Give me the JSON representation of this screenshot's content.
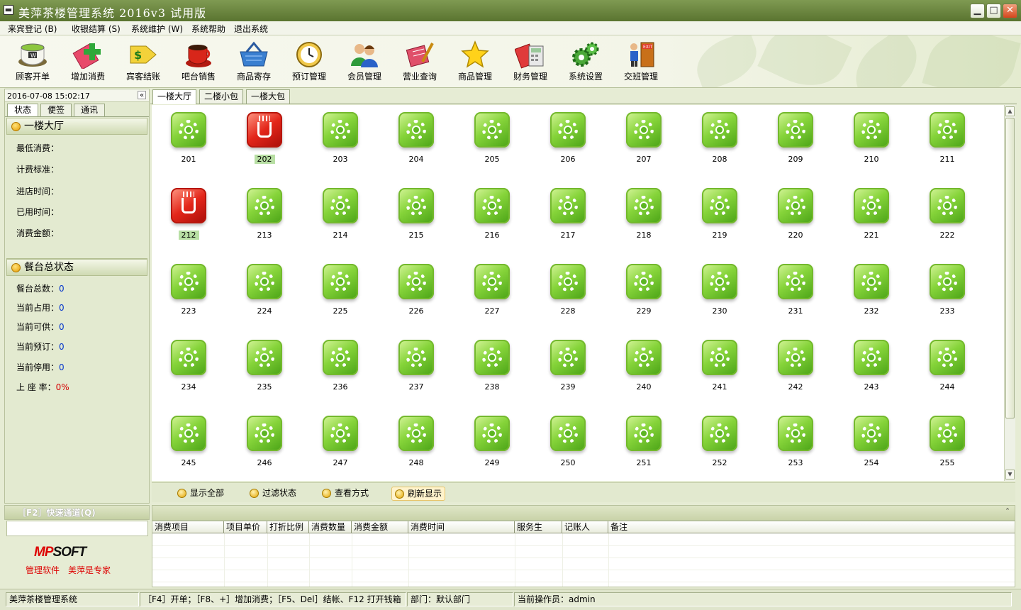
{
  "window": {
    "title": "美萍茶楼管理系统 2016v3 试用版",
    "controls": [
      "minimize",
      "maximize",
      "close"
    ]
  },
  "menu": [
    {
      "label": "来宾登记 (B)"
    },
    {
      "label": "收银结算 (S)"
    },
    {
      "label": "系统维护 (W)"
    },
    {
      "label": "系统帮助"
    },
    {
      "label": "退出系统"
    }
  ],
  "toolbar": [
    {
      "label": "顾客开单",
      "icon": "tea-cup-icon"
    },
    {
      "label": "增加消费",
      "icon": "add-consumption-icon"
    },
    {
      "label": "宾客结账",
      "icon": "checkout-icon"
    },
    {
      "label": "吧台销售",
      "icon": "bar-cup-icon"
    },
    {
      "label": "商品寄存",
      "icon": "basket-icon"
    },
    {
      "label": "预订管理",
      "icon": "clock-icon"
    },
    {
      "label": "会员管理",
      "icon": "members-icon"
    },
    {
      "label": "营业查询",
      "icon": "query-icon"
    },
    {
      "label": "商品管理",
      "icon": "star-icon"
    },
    {
      "label": "财务管理",
      "icon": "calculator-icon"
    },
    {
      "label": "系统设置",
      "icon": "gears-icon"
    },
    {
      "label": "交班管理",
      "icon": "exit-door-icon"
    }
  ],
  "sidebar": {
    "datetime": "2016-07-08 15:02:17",
    "collapse_label": "«",
    "tabs": [
      "状态",
      "便签",
      "通讯"
    ],
    "active_tab": "状态",
    "section1": {
      "title": "一楼大厅",
      "fields": [
        {
          "label": "最低消费：",
          "value": ""
        },
        {
          "label": "计费标准：",
          "value": ""
        },
        {
          "label": "进店时间：",
          "value": ""
        },
        {
          "label": "已用时间：",
          "value": ""
        },
        {
          "label": "消费金额：",
          "value": ""
        }
      ]
    },
    "section2": {
      "title": "餐台总状态",
      "fields": [
        {
          "label": "餐台总数：",
          "value": "0"
        },
        {
          "label": "当前占用：",
          "value": "0"
        },
        {
          "label": "当前可供：",
          "value": "0"
        },
        {
          "label": "当前预订：",
          "value": "0"
        },
        {
          "label": "当前停用：",
          "value": "0"
        },
        {
          "label": "上 座 率：",
          "value": "0%"
        }
      ]
    },
    "quick_channel": "［F2］快速通道(Q)",
    "quick_input_value": "",
    "logo": {
      "part1": "MP",
      "part2": "SOFT"
    },
    "slogan": "管理软件　美萍是专家"
  },
  "main_tabs": [
    "一楼大厅",
    "二楼小包",
    "一楼大包"
  ],
  "active_main_tab": "一楼大厅",
  "rooms": [
    {
      "number": "201",
      "status": "free"
    },
    {
      "number": "202",
      "status": "occupied",
      "selected": true
    },
    {
      "number": "203",
      "status": "free"
    },
    {
      "number": "204",
      "status": "free"
    },
    {
      "number": "205",
      "status": "free"
    },
    {
      "number": "206",
      "status": "free"
    },
    {
      "number": "207",
      "status": "free"
    },
    {
      "number": "208",
      "status": "free"
    },
    {
      "number": "209",
      "status": "free"
    },
    {
      "number": "210",
      "status": "free"
    },
    {
      "number": "211",
      "status": "free"
    },
    {
      "number": "212",
      "status": "occupied",
      "selected": true
    },
    {
      "number": "213",
      "status": "free"
    },
    {
      "number": "214",
      "status": "free"
    },
    {
      "number": "215",
      "status": "free"
    },
    {
      "number": "216",
      "status": "free"
    },
    {
      "number": "217",
      "status": "free"
    },
    {
      "number": "218",
      "status": "free"
    },
    {
      "number": "219",
      "status": "free"
    },
    {
      "number": "220",
      "status": "free"
    },
    {
      "number": "221",
      "status": "free"
    },
    {
      "number": "222",
      "status": "free"
    },
    {
      "number": "223",
      "status": "free"
    },
    {
      "number": "224",
      "status": "free"
    },
    {
      "number": "225",
      "status": "free"
    },
    {
      "number": "226",
      "status": "free"
    },
    {
      "number": "227",
      "status": "free"
    },
    {
      "number": "228",
      "status": "free"
    },
    {
      "number": "229",
      "status": "free"
    },
    {
      "number": "230",
      "status": "free"
    },
    {
      "number": "231",
      "status": "free"
    },
    {
      "number": "232",
      "status": "free"
    },
    {
      "number": "233",
      "status": "free"
    },
    {
      "number": "234",
      "status": "free"
    },
    {
      "number": "235",
      "status": "free"
    },
    {
      "number": "236",
      "status": "free"
    },
    {
      "number": "237",
      "status": "free"
    },
    {
      "number": "238",
      "status": "free"
    },
    {
      "number": "239",
      "status": "free"
    },
    {
      "number": "240",
      "status": "free"
    },
    {
      "number": "241",
      "status": "free"
    },
    {
      "number": "242",
      "status": "free"
    },
    {
      "number": "243",
      "status": "free"
    },
    {
      "number": "244",
      "status": "free"
    },
    {
      "number": "245",
      "status": "free"
    },
    {
      "number": "246",
      "status": "free"
    },
    {
      "number": "247",
      "status": "free"
    },
    {
      "number": "248",
      "status": "free"
    },
    {
      "number": "249",
      "status": "free"
    },
    {
      "number": "250",
      "status": "free"
    },
    {
      "number": "251",
      "status": "free"
    },
    {
      "number": "252",
      "status": "free"
    },
    {
      "number": "253",
      "status": "free"
    },
    {
      "number": "254",
      "status": "free"
    },
    {
      "number": "255",
      "status": "free"
    }
  ],
  "filter_buttons": [
    {
      "label": "显示全部"
    },
    {
      "label": "过滤状态"
    },
    {
      "label": "查看方式"
    },
    {
      "label": "刷新显示",
      "active": true
    }
  ],
  "detail_table": {
    "collapse_label": "⌃",
    "columns": [
      "消费项目",
      "项目单价",
      "打折比例",
      "消费数量",
      "消费金额",
      "消费时间",
      "服务生",
      "记账人",
      "备注"
    ],
    "rows": []
  },
  "statusbar": [
    {
      "text": "美萍茶楼管理系统"
    },
    {
      "text": "［F4］开单；［F8、+］增加消费；［F5、Del］结帐、F12 打开钱箱"
    },
    {
      "text": "部门：默认部门"
    },
    {
      "text": "当前操作员：admin"
    }
  ],
  "colors": {
    "free_room": "#6cc02a",
    "occupied_room": "#e0231a",
    "selected_label_bg": "#b8dfa4",
    "title_bar": "#6b8440",
    "panel_bg": "#e3ead0",
    "stat_value": "#0033cc",
    "rate_value": "#d40000",
    "logo_red": "#d00000"
  }
}
